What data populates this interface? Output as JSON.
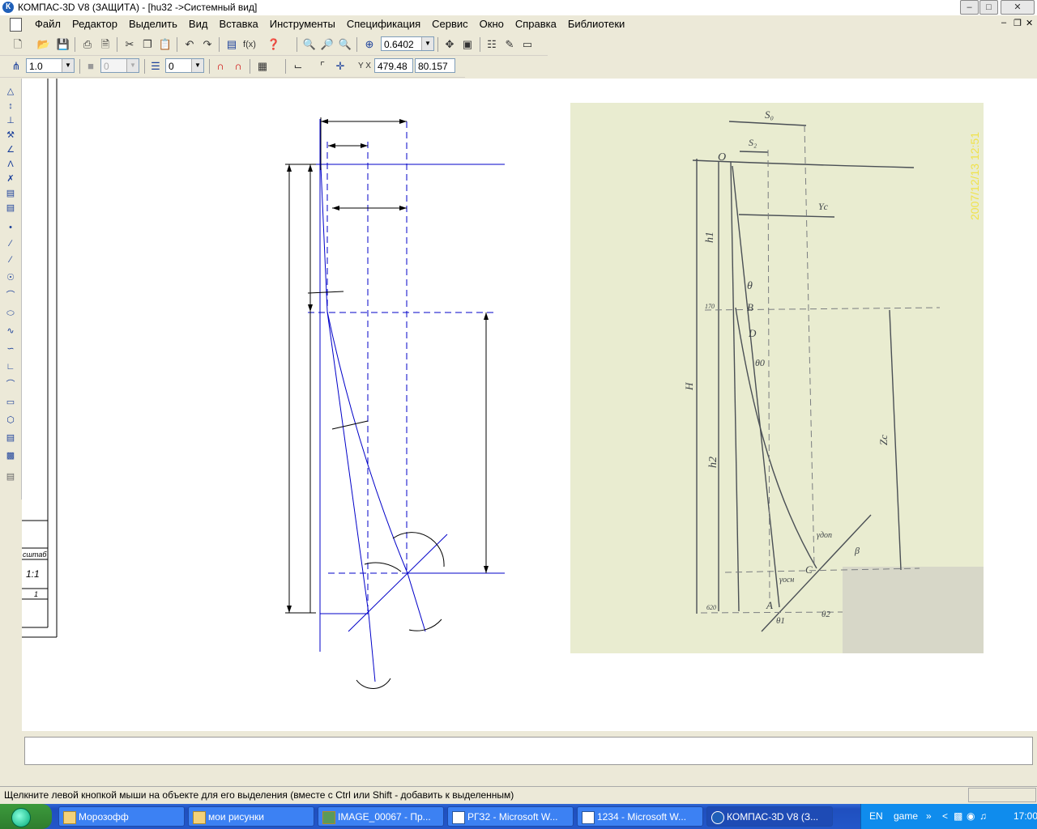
{
  "window": {
    "title": "КОМПАС-3D V8 (ЗАЩИТА) - [hu32 ->Системный вид]",
    "app_icon": "К"
  },
  "menubar": {
    "items": [
      "Файл",
      "Редактор",
      "Выделить",
      "Вид",
      "Вставка",
      "Инструменты",
      "Спецификация",
      "Сервис",
      "Окно",
      "Справка",
      "Библиотеки"
    ]
  },
  "toolbar1": {
    "zoom_value": "0.6402"
  },
  "toolbar2": {
    "scale_value": "1.0",
    "style_value": "0",
    "layer_value": "0",
    "coord_x": "479.48",
    "coord_y": "80.157"
  },
  "stamp": {
    "label": "сштаб",
    "value": "1:1",
    "sheet": "1"
  },
  "photo": {
    "date_stamp": "2007/12/13 12:51",
    "labels": [
      "S₀",
      "S₂",
      "O",
      "Yc",
      "h1",
      "θ",
      "170",
      "B",
      "D",
      "θ0",
      "H",
      "Zc",
      "h2",
      "γдоп",
      "β",
      "C",
      "γосн",
      "620",
      "A",
      "θ1",
      "θ2"
    ]
  },
  "status": {
    "text": "Щелкните левой кнопкой мыши на объекте для его выделения (вместе с Ctrl или Shift - добавить к выделенным)"
  },
  "taskbar": {
    "tasks": [
      "Морозофф",
      "мои рисунки",
      "IMAGE_00067 - Пр...",
      "РГЗ2 - Microsoft W...",
      "1234 - Microsoft W...",
      "КОМПАС-3D V8 (З..."
    ],
    "lang": "EN",
    "user": "game",
    "clock": "17:00"
  },
  "colors": {
    "drawing_line": "#0000c8",
    "photo_bg": "#e9ecd0",
    "taskbar": "#245edb"
  }
}
